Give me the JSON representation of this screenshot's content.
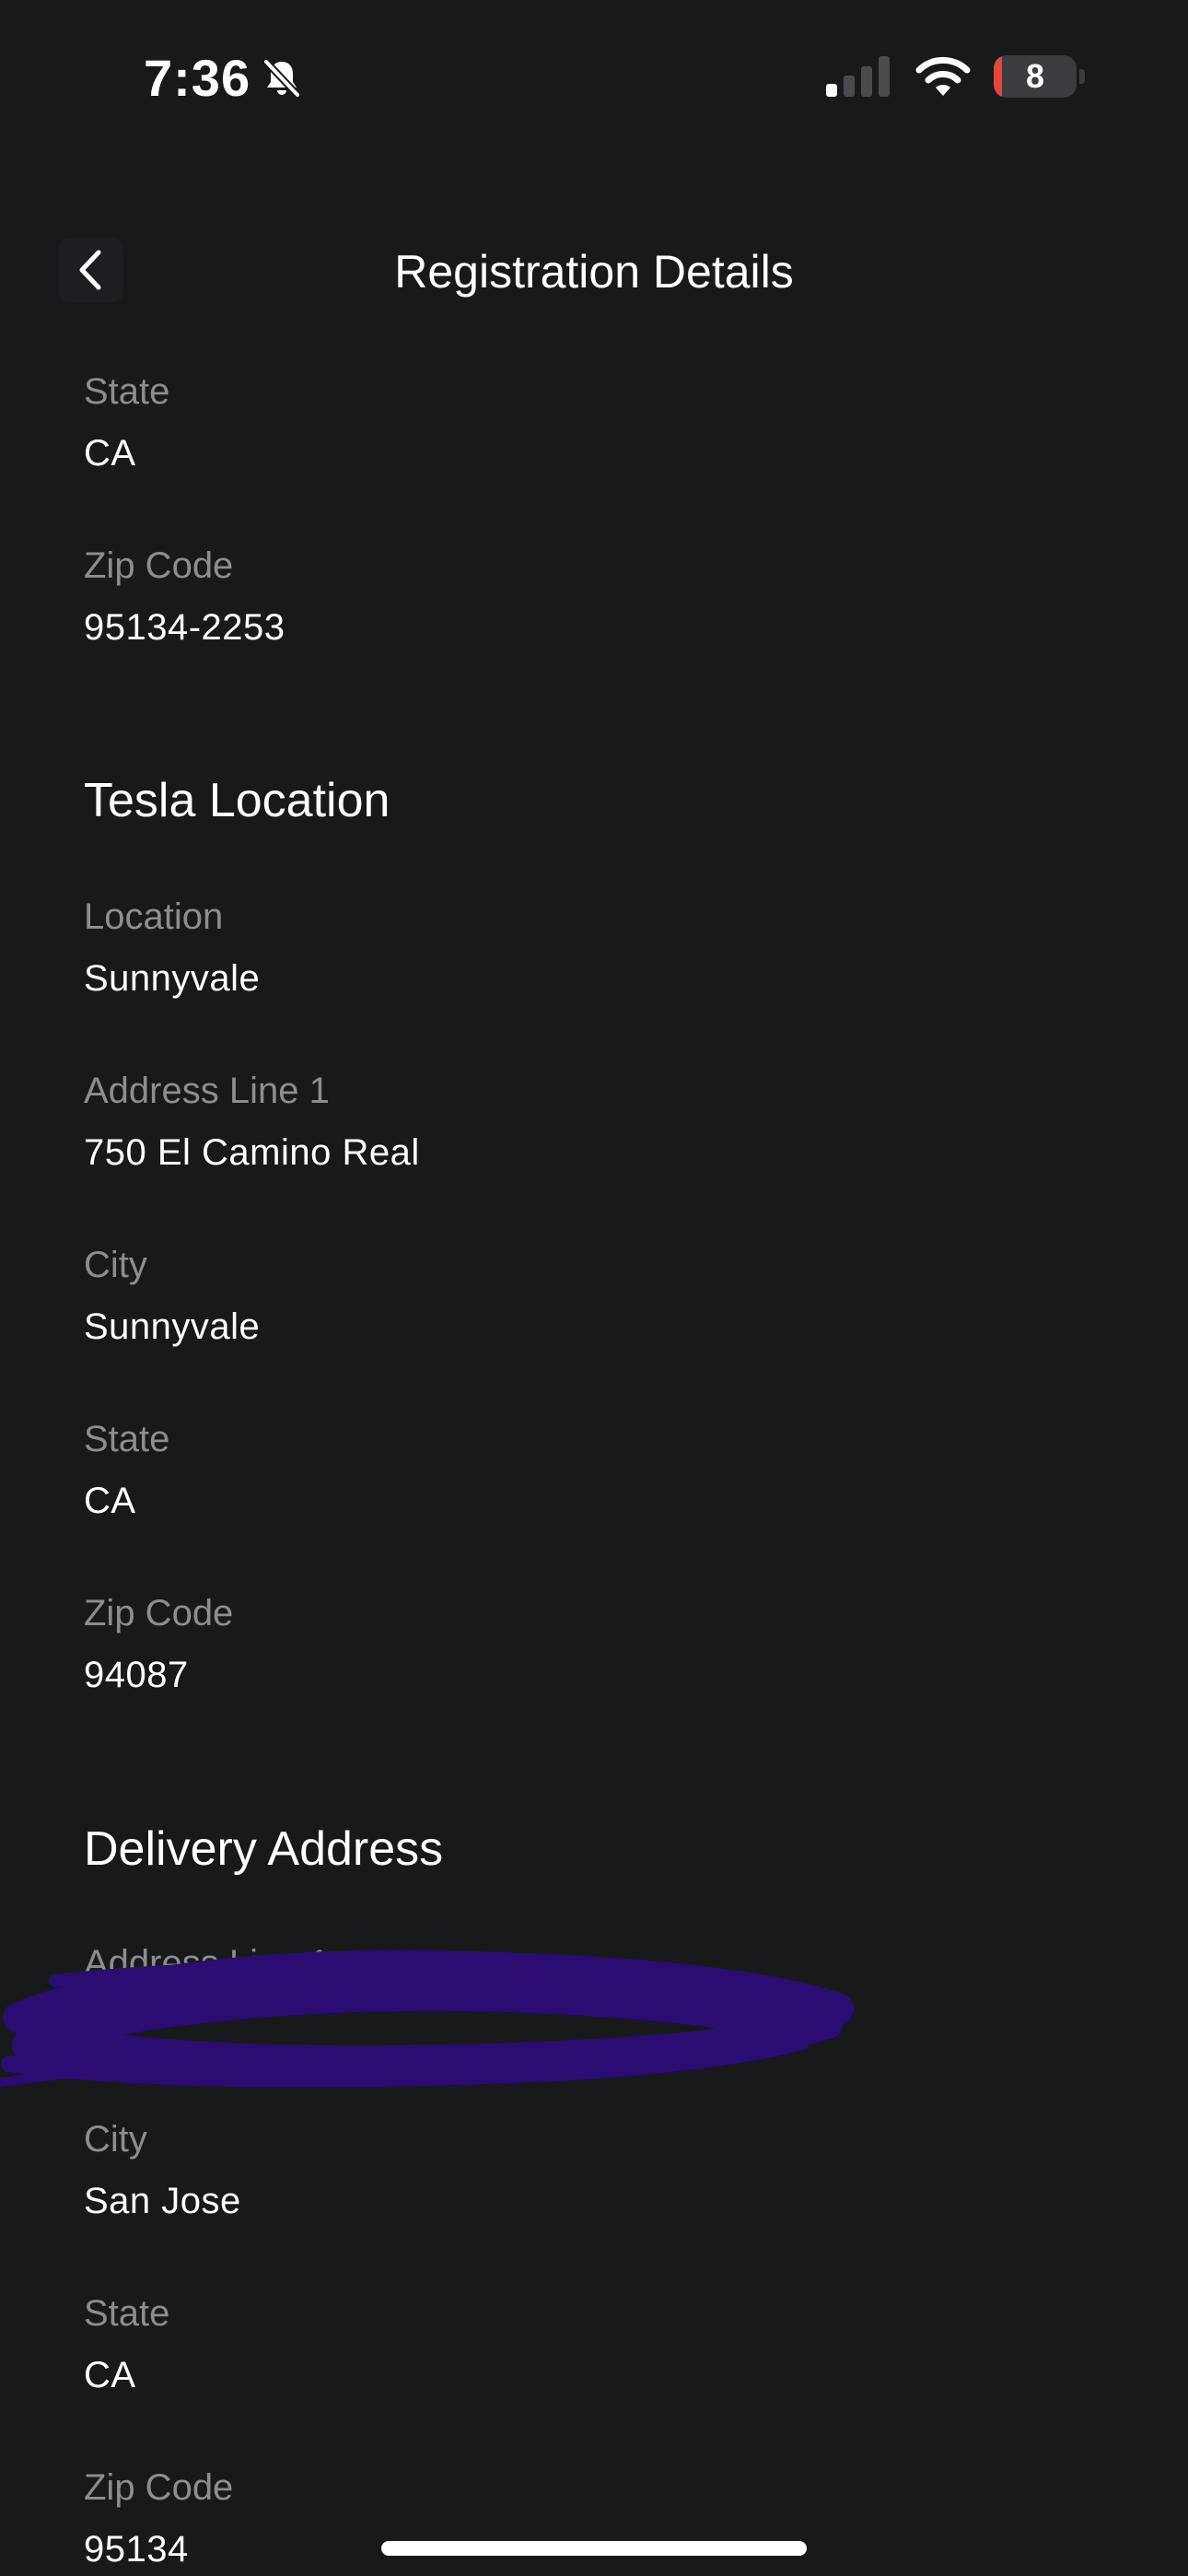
{
  "status_bar": {
    "time": "7:36",
    "battery_level": "8",
    "battery_fraction": 0.08,
    "signal_bars_active": 1,
    "signal_bars_total": 4,
    "icons": [
      "bell-slash-icon",
      "cellular-signal-icon",
      "wifi-icon",
      "battery-icon"
    ]
  },
  "header": {
    "title": "Registration Details",
    "back_icon": "chevron-left-icon"
  },
  "registration_address": {
    "fields": [
      {
        "label": "State",
        "value": "CA"
      },
      {
        "label": "Zip Code",
        "value": "95134-2253"
      }
    ]
  },
  "tesla_location": {
    "title": "Tesla Location",
    "fields": [
      {
        "label": "Location",
        "value": "Sunnyvale"
      },
      {
        "label": "Address Line 1",
        "value": "750 El Camino Real"
      },
      {
        "label": "City",
        "value": "Sunnyvale"
      },
      {
        "label": "State",
        "value": "CA"
      },
      {
        "label": "Zip Code",
        "value": "94087"
      }
    ]
  },
  "delivery_address": {
    "title": "Delivery Address",
    "fields": [
      {
        "label": "Address Line 1",
        "value": ""
      },
      {
        "label": "City",
        "value": "San Jose"
      },
      {
        "label": "State",
        "value": "CA"
      },
      {
        "label": "Zip Code",
        "value": "95134"
      }
    ]
  },
  "colors": {
    "background": "#18191b",
    "label": "#8c8d90",
    "value": "#ffffff",
    "battery_low": "#e5453a",
    "redaction": "#2a0d73"
  }
}
